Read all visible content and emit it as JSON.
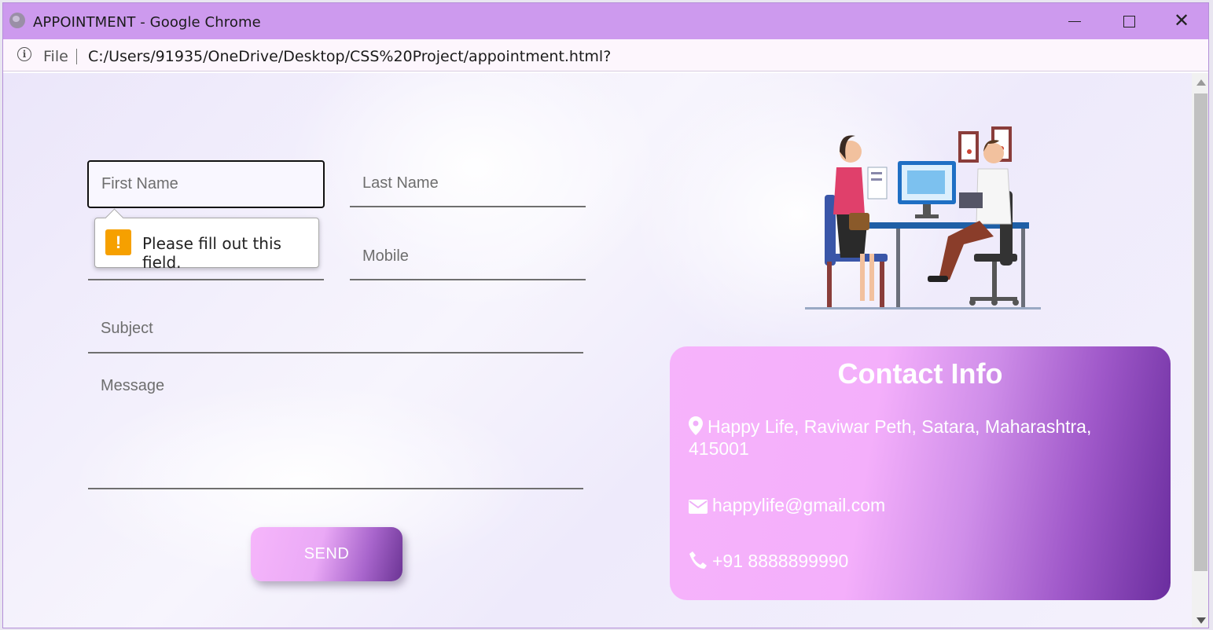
{
  "window": {
    "title": "APPOINTMENT - Google Chrome",
    "minimize_icon": "minimize-icon",
    "maximize_icon": "maximize-icon",
    "close_icon": "close-icon",
    "close_glyph": "✕"
  },
  "addressbar": {
    "info_icon": "info-icon",
    "info_glyph": "i",
    "scheme": "File",
    "url": "C:/Users/91935/OneDrive/Desktop/CSS%20Project/appointment.html?"
  },
  "form": {
    "first_name_placeholder": "First Name",
    "last_name_placeholder": "Last Name",
    "email_placeholder": "",
    "mobile_placeholder": "Mobile",
    "subject_placeholder": "Subject",
    "message_placeholder": "Message",
    "send_label": "SEND"
  },
  "validation_tooltip": {
    "icon": "warning-icon",
    "glyph": "!",
    "message": "Please fill out this field."
  },
  "illustration": {
    "icon": "doctor-consultation-illustration"
  },
  "contact": {
    "title": "Contact Info",
    "address_icon": "map-pin-icon",
    "address_line1": "Happy Life, Raviwar Peth, Satara, Maharashtra,",
    "address_line2": "415001",
    "email_icon": "envelope-icon",
    "email": "happylife@gmail.com",
    "phone_icon": "phone-icon",
    "phone": "+91 8888899990"
  },
  "colors": {
    "titlebar": "#cd9aee",
    "contact_card_start": "#f6b3fb",
    "contact_card_end": "#6a2d9e",
    "warning": "#f6a000"
  }
}
